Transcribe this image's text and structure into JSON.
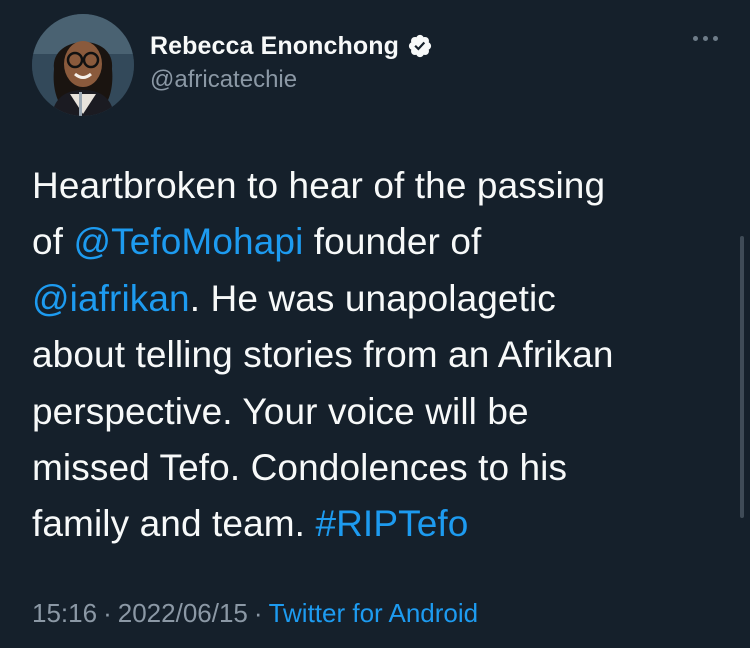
{
  "author": {
    "display_name": "Rebecca Enonchong",
    "handle": "@africatechie",
    "verified": true,
    "verified_icon": "verified-badge-icon"
  },
  "tweet": {
    "line1": "Heartbroken to hear of the passing",
    "line2_pre": "of ",
    "mention1": "@TefoMohapi",
    "line2_post": " founder of",
    "mention2": "@iafrikan",
    "line3_post": ". He was unapolagetic",
    "line4": "about telling stories from an Afrikan",
    "line5": "perspective. Your voice will be",
    "line6": "missed Tefo. Condolences to his",
    "line7_pre": "family and team. ",
    "hashtag": "#RIPTefo"
  },
  "meta": {
    "time": "15:16",
    "date": "2022/06/15",
    "separator": "·",
    "source": "Twitter for Android"
  },
  "more_icon": "more-options-icon",
  "colors": {
    "background": "#15202b",
    "text": "#f7f9f9",
    "secondary": "#8b98a5",
    "link": "#1d9bf0"
  }
}
